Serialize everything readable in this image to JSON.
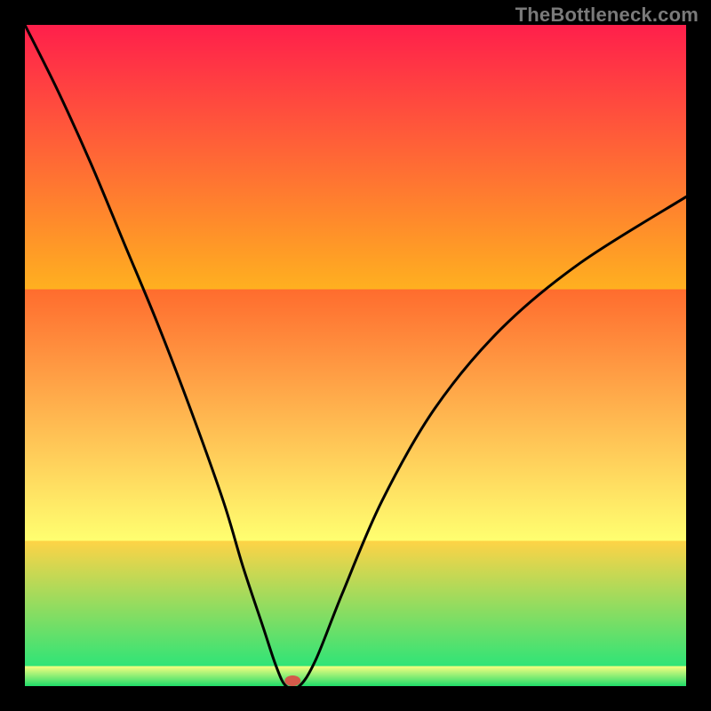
{
  "watermark": "TheBottleneck.com",
  "chart_data": {
    "type": "line",
    "title": "",
    "xlabel": "",
    "ylabel": "",
    "xlim": [
      0,
      100
    ],
    "ylim": [
      0,
      100
    ],
    "grid": false,
    "legend": false,
    "background_bands": [
      {
        "name": "green",
        "from": 0,
        "to": 3,
        "color_top": "#2fe477",
        "color_bottom": "#1fdc6a"
      },
      {
        "name": "yellow",
        "from": 3,
        "to": 22,
        "color_top": "#ffff70",
        "color_bottom": "#f6ff80"
      },
      {
        "name": "orange",
        "from": 22,
        "to": 60,
        "color_top": "#ffb020",
        "color_bottom": "#ffd346"
      },
      {
        "name": "red",
        "from": 60,
        "to": 100,
        "color_top": "#ff1f4b",
        "color_bottom": "#ff6c2e"
      }
    ],
    "series": [
      {
        "name": "bottleneck-curve",
        "x": [
          0,
          5,
          10,
          15,
          20,
          25,
          30,
          33,
          36,
          38,
          39.5,
          41.5,
          44,
          48,
          54,
          62,
          72,
          84,
          100
        ],
        "y": [
          100,
          90,
          79,
          67,
          55,
          42,
          28,
          18,
          9,
          3,
          0,
          0,
          4,
          14,
          28,
          42,
          54,
          64,
          74
        ]
      }
    ],
    "markers": [
      {
        "name": "optimal-point",
        "x": 40.5,
        "y": 0.8,
        "color": "#d45a4a",
        "rx": 9,
        "ry": 6
      }
    ]
  }
}
